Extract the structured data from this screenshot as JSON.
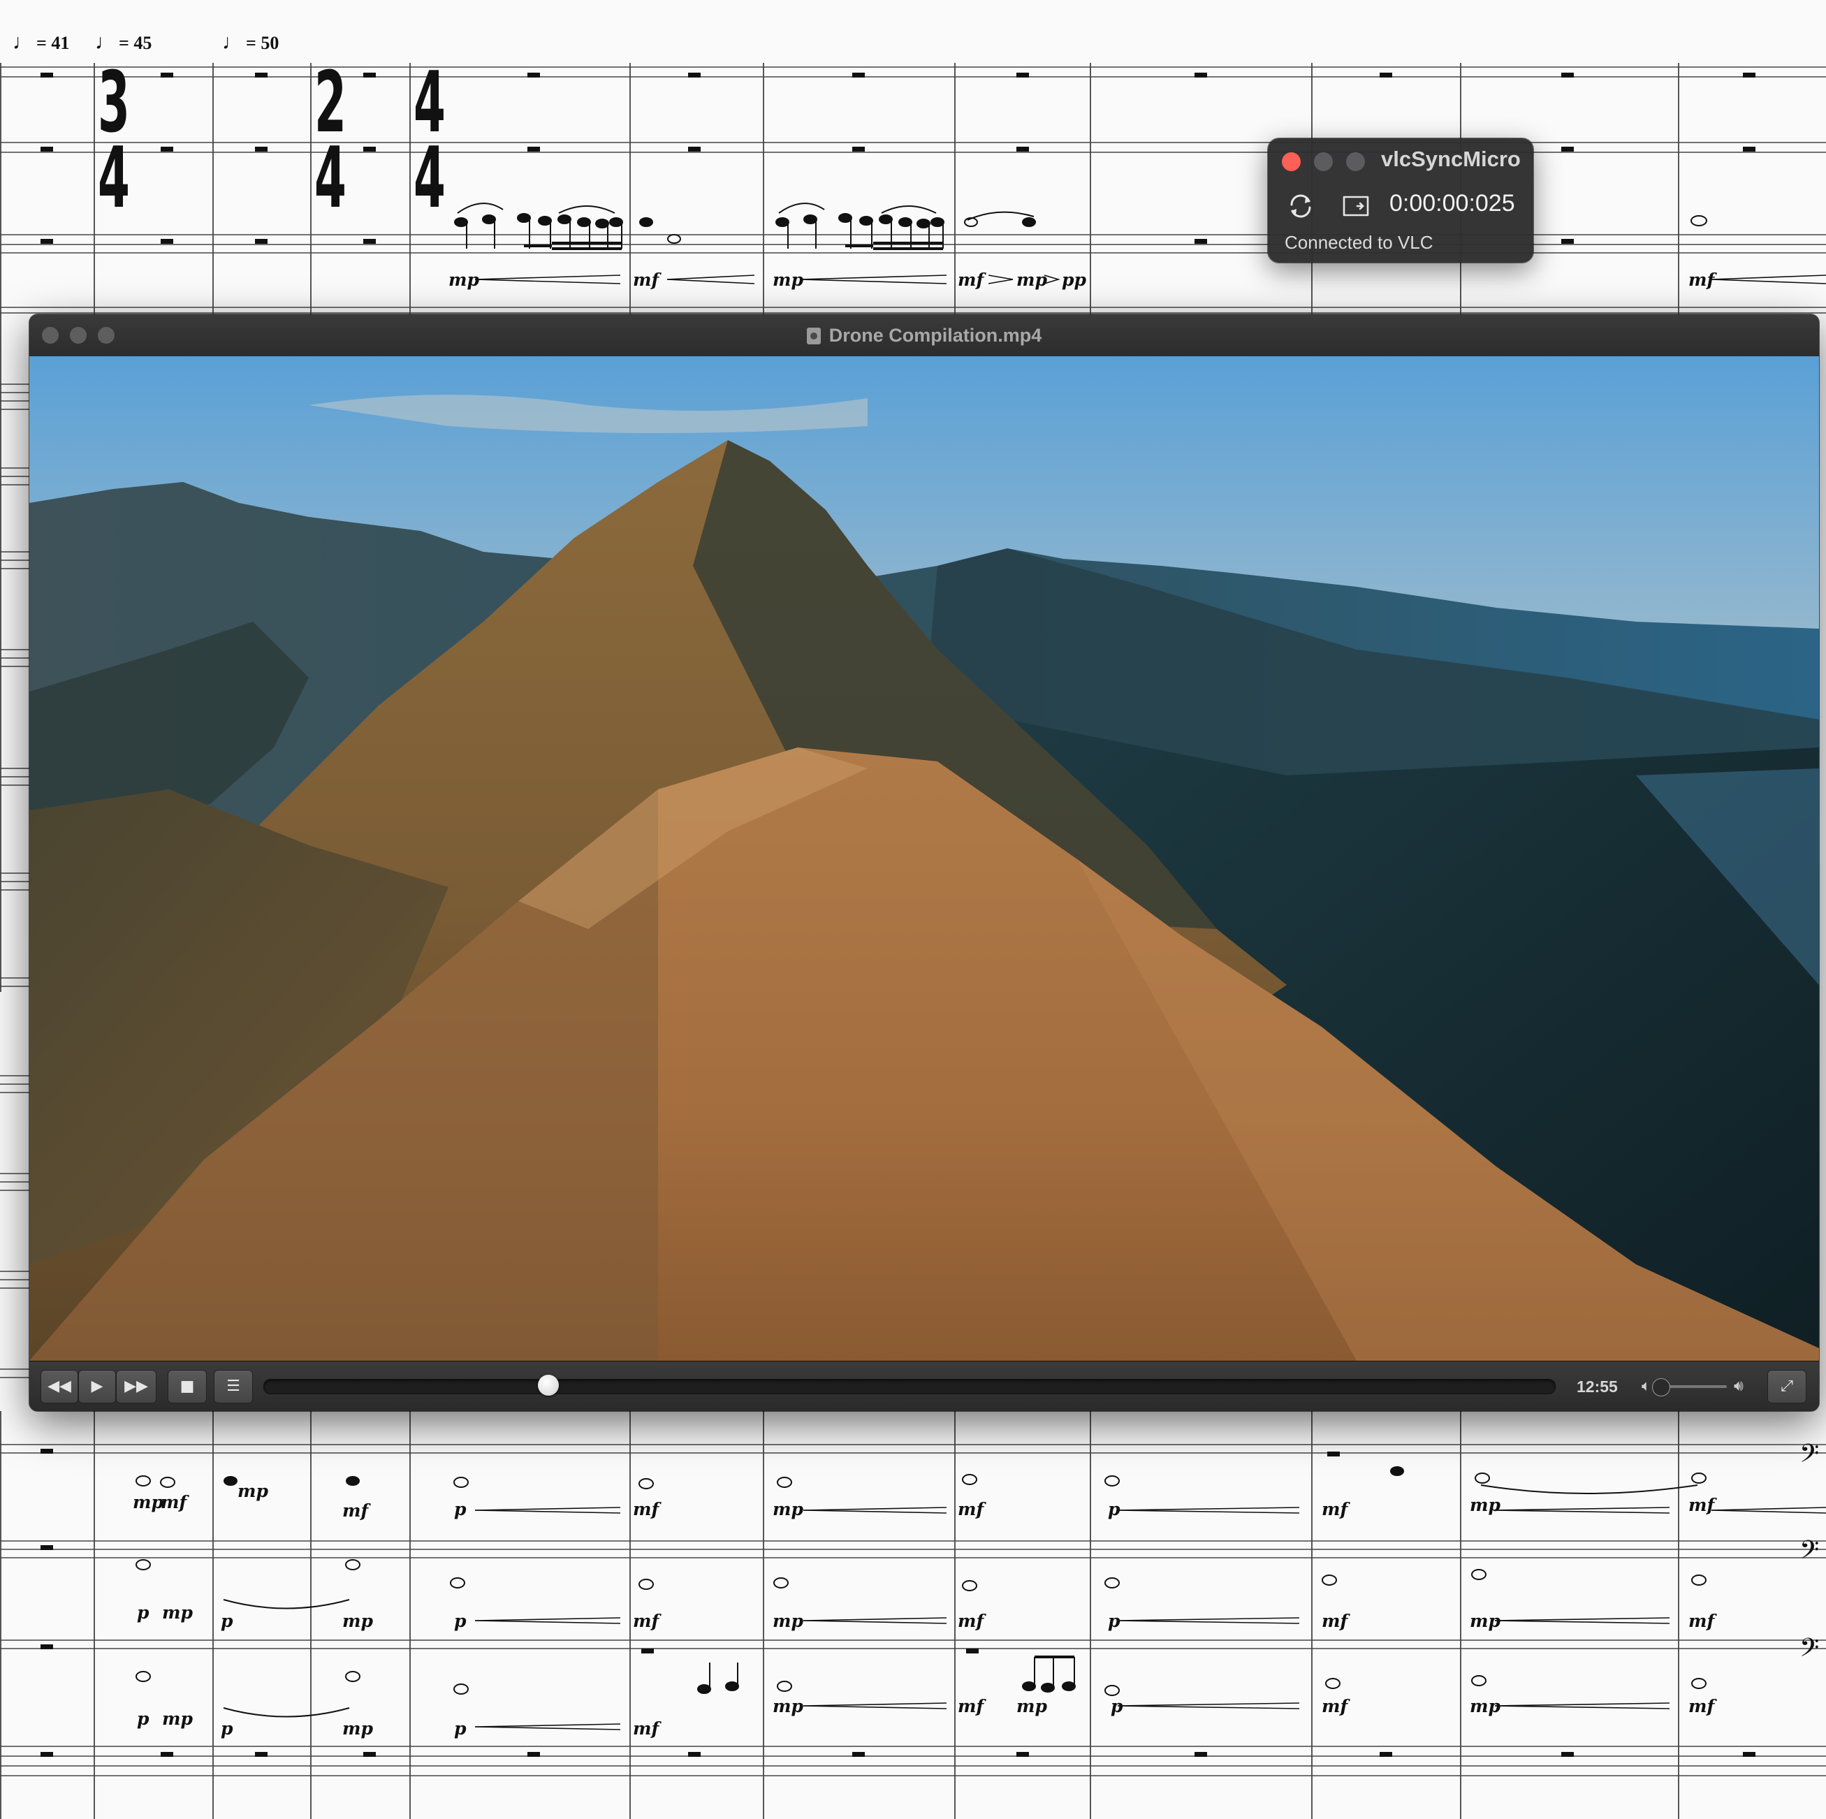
{
  "score": {
    "tempo_marks": [
      {
        "glyph": "♩",
        "text": "= 41"
      },
      {
        "glyph": "♩",
        "text": "= 45"
      },
      {
        "glyph": "♩",
        "text": "= 50"
      }
    ],
    "time_signatures": [
      {
        "top": "3",
        "bottom": "4"
      },
      {
        "top": "2",
        "bottom": "4"
      },
      {
        "top": "4",
        "bottom": "4"
      }
    ],
    "top_dynamics": [
      "mp",
      "mf",
      "mp",
      "mf",
      "mp",
      "pp",
      "mf"
    ],
    "bottom_dynamics_row1": [
      "mp",
      "mf",
      "mp",
      "mf",
      "p",
      "mf",
      "mp",
      "mf",
      "p",
      "mf",
      "mp",
      "mf"
    ],
    "bottom_dynamics_row2": [
      "p",
      "mp",
      "p",
      "mp",
      "p",
      "mf",
      "mp",
      "mf",
      "p",
      "mf",
      "mp",
      "mf"
    ],
    "bottom_dynamics_row3": [
      "p",
      "mp",
      "p",
      "mp",
      "p",
      "mf",
      "mp",
      "mf",
      "mp",
      "p",
      "mf",
      "mp",
      "mf"
    ]
  },
  "video_window": {
    "title": "Drone Compilation.mp4",
    "controls": {
      "rewind": "◀◀",
      "play": "▶",
      "fast_forward": "▶▶",
      "stop": "■",
      "playlist": "☰",
      "fullscreen": "⤢"
    },
    "playback_position": 0.22,
    "time": "12:55",
    "volume_level": 0.05
  },
  "sync_panel": {
    "title": "vlcSyncMicro",
    "timecode": "0:00:00:025",
    "status": "Connected to VLC",
    "colors": {
      "close": "#fe5f57",
      "inactive": "#5c5c5e"
    }
  }
}
